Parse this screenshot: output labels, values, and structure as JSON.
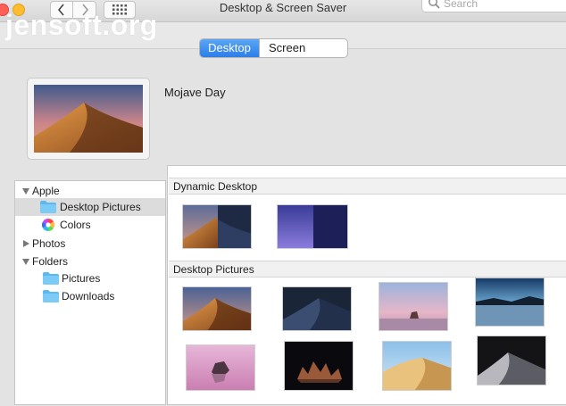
{
  "window": {
    "title": "Desktop & Screen Saver"
  },
  "toolbar": {
    "search_placeholder": "Search"
  },
  "watermark": "jensoft.org",
  "tabs": [
    {
      "label": "Desktop",
      "active": true
    },
    {
      "label": "Screen Saver",
      "active": false
    }
  ],
  "current": {
    "name": "Mojave Day"
  },
  "sidebar": {
    "items": [
      {
        "label": "Apple",
        "type": "group",
        "expanded": true
      },
      {
        "label": "Desktop Pictures",
        "type": "folder",
        "selected": true
      },
      {
        "label": "Colors",
        "type": "colors"
      },
      {
        "label": "Photos",
        "type": "group",
        "expanded": false
      },
      {
        "label": "Folders",
        "type": "group",
        "expanded": true
      },
      {
        "label": "Pictures",
        "type": "folder"
      },
      {
        "label": "Downloads",
        "type": "folder"
      }
    ]
  },
  "sections": [
    {
      "title": "Dynamic Desktop"
    },
    {
      "title": "Desktop Pictures"
    }
  ],
  "colors": {
    "accent": "#2c7ee8",
    "folder": "#5cb8f0",
    "close": "#fe5f57",
    "minimize": "#febc2e"
  }
}
